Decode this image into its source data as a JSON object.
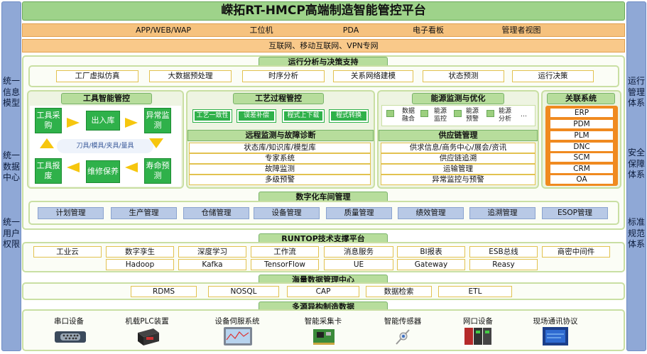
{
  "title": "嵘拓RT-HMCP高端制造智能管控平台",
  "left_side": {
    "text1": "统一信息模型",
    "text2": "统一数据中心",
    "text3": "统一用户权限"
  },
  "right_side": {
    "text1": "运行管理体系",
    "text2": "安全保障体系",
    "text3": "标准规范体系"
  },
  "access_bar": [
    "APP/WEB/WAP",
    "工位机",
    "PDA",
    "电子看板",
    "管理者视图"
  ],
  "network_bar": "互联网、移动互联网、VPN专网",
  "analysis": {
    "title": "运行分析与决策支持",
    "items": [
      "工厂虚拟仿真",
      "大数据预处理",
      "时序分析",
      "关系网络建模",
      "状态预测",
      "运行决策"
    ]
  },
  "tool_mgmt": {
    "title": "工具智能管控",
    "nodes": {
      "purchase": "工具采购",
      "inout": "出入库",
      "abnormal": "异常监测",
      "scrap": "工具报废",
      "repair": "维修保养",
      "life": "寿命预测"
    },
    "center": "刀具/模具/夹具/量具"
  },
  "process_mgmt": {
    "title": "工艺过程管控",
    "items": [
      "工艺一致性",
      "误差补偿",
      "程式上下载",
      "程式转换"
    ]
  },
  "remote": {
    "title": "远程监测与故障诊断",
    "items": [
      "状态库/知识库/模型库",
      "专家系统",
      "故障监测",
      "多级预警"
    ]
  },
  "energy": {
    "title": "能源监测与优化",
    "items": [
      "数据融合",
      "能源监控",
      "能源预警",
      "能源分析",
      "…"
    ]
  },
  "supply": {
    "title": "供应链管理",
    "items": [
      "供求信息/商务中心/展会/资讯",
      "供应链追溯",
      "运输管理",
      "异常监控与预警"
    ]
  },
  "related": {
    "title": "关联系统",
    "items": [
      "ERP",
      "PDM",
      "PLM",
      "DNC",
      "SCM",
      "CRM",
      "OA"
    ]
  },
  "workshop": {
    "title": "数字化车间管理",
    "items": [
      "计划管理",
      "生产管理",
      "仓储管理",
      "设备管理",
      "质量管理",
      "绩效管理",
      "追溯管理",
      "ESOP管理"
    ]
  },
  "runtop": {
    "title": "RUNTOP技术支撑平台",
    "row1": [
      "工业云",
      "数字孪生",
      "深度学习",
      "工作流",
      "消息服务",
      "BI报表",
      "ESB总线",
      "商密中间件"
    ],
    "row2": [
      "Hadoop",
      "Kafka",
      "TensorFlow",
      "UE",
      "Gateway",
      "Reasy"
    ]
  },
  "data_center": {
    "title": "海量数据管理中心",
    "items": [
      "RDMS",
      "NOSQL",
      "CAP",
      "数据检索",
      "ETL"
    ]
  },
  "sources": {
    "title": "多源异构制造数据",
    "items": [
      "串口设备",
      "机载PLC装置",
      "设备伺服系统",
      "智能采集卡",
      "智能传感器",
      "网口设备",
      "现场通讯协议"
    ]
  },
  "colors": {
    "green_accent": "#2fb14a",
    "title_green": "#9ed38a",
    "orange": "#f6c27e",
    "side_blue": "#8fa8d6",
    "workshop_blue": "#b8c9e6",
    "related_orange": "#f08a20"
  }
}
